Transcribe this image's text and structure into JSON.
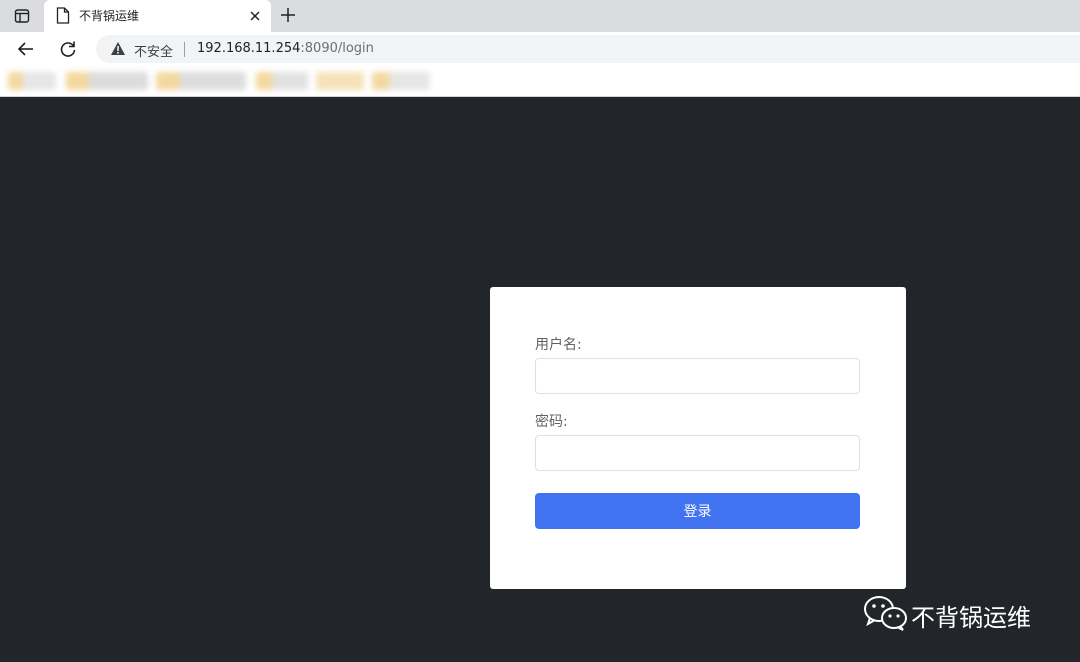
{
  "browser": {
    "tab": {
      "title": "不背锅运维"
    },
    "address_bar": {
      "security_label": "不安全",
      "url_host": "192.168.11.254",
      "url_rest": ":8090/login"
    },
    "icons": {
      "window": "sidebar-window-icon",
      "page": "page-icon",
      "close": "close-icon",
      "new_tab": "plus-icon",
      "back": "back-arrow-icon",
      "reload": "reload-icon",
      "warning": "warning-icon"
    }
  },
  "login": {
    "username_label": "用户名:",
    "username_value": "",
    "password_label": "密码:",
    "password_value": "",
    "submit_label": "登录"
  },
  "watermark": {
    "text": "不背锅运维",
    "logo": "wechat-logo"
  },
  "colors": {
    "page_background": "#222529",
    "card_background": "#ffffff",
    "button_primary": "#4172f0",
    "tabstrip": "#dadcdf"
  }
}
